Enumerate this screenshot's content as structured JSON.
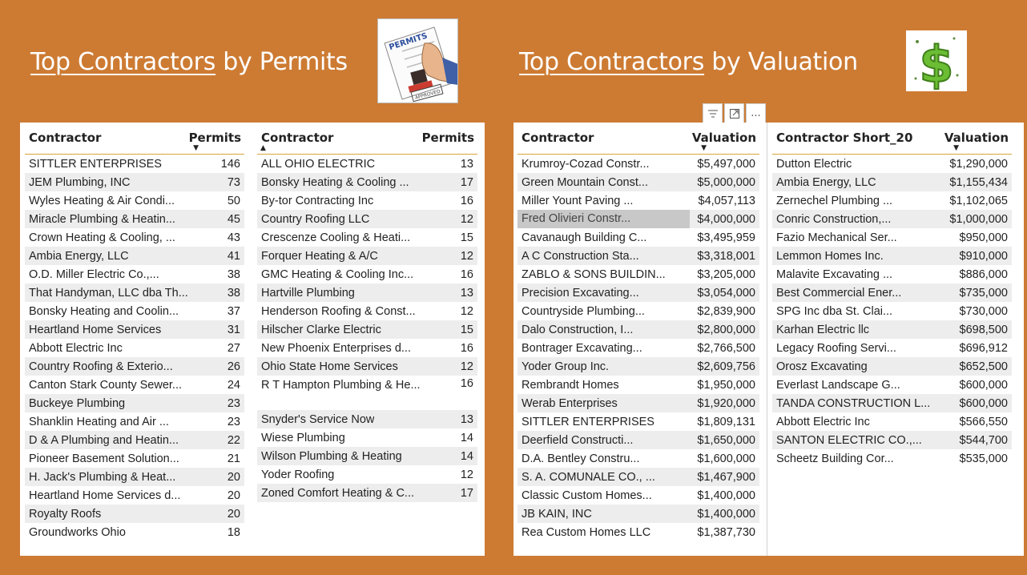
{
  "permits_section": {
    "title_link": "Top Contractors",
    "title_rest": " by Permits"
  },
  "valuation_section": {
    "title_link": "Top Contractors",
    "title_rest": " by Valuation"
  },
  "icons": {
    "permits": "permits-approved-stamp-icon",
    "dollar": "dollar-sign-icon"
  },
  "permits_table_1": {
    "headers": [
      "Contractor",
      "Permits"
    ],
    "sort": "descending-on-Permits",
    "rows": [
      [
        "SITTLER ENTERPRISES",
        "146"
      ],
      [
        "JEM Plumbing, INC",
        "73"
      ],
      [
        "Wyles Heating & Air Condi...",
        "50"
      ],
      [
        "Miracle Plumbing & Heatin...",
        "45"
      ],
      [
        "Crown Heating & Cooling, ...",
        "43"
      ],
      [
        "Ambia Energy, LLC",
        "41"
      ],
      [
        "O.D. Miller Electric Co.,...",
        "38"
      ],
      [
        "That Handyman, LLC dba Th...",
        "38"
      ],
      [
        "Bonsky Heating and Coolin...",
        "37"
      ],
      [
        "Heartland Home Services",
        "31"
      ],
      [
        "Abbott Electric Inc",
        "27"
      ],
      [
        "Country Roofing & Exterio...",
        "26"
      ],
      [
        "Canton Stark County Sewer...",
        "24"
      ],
      [
        "Buckeye Plumbing",
        "23"
      ],
      [
        "Shanklin Heating and Air ...",
        "23"
      ],
      [
        "D & A Plumbing and Heatin...",
        "22"
      ],
      [
        "Pioneer Basement Solution...",
        "21"
      ],
      [
        "H. Jack's Plumbing & Heat...",
        "20"
      ],
      [
        "Heartland Home Services d...",
        "20"
      ],
      [
        "Royalty Roofs",
        "20"
      ],
      [
        "Groundworks Ohio",
        "18"
      ]
    ]
  },
  "permits_table_2": {
    "headers": [
      "Contractor",
      "Permits"
    ],
    "sort": "ascending-on-Contractor",
    "rows": [
      [
        "ALL OHIO ELECTRIC",
        "13"
      ],
      [
        "Bonsky Heating & Cooling ...",
        "17"
      ],
      [
        "By-tor Contracting Inc",
        "16"
      ],
      [
        "Country Roofing LLC",
        "12"
      ],
      [
        "Crescenze Cooling & Heati...",
        "15"
      ],
      [
        "Forquer Heating & A/C",
        "12"
      ],
      [
        "GMC Heating & Cooling Inc...",
        "16"
      ],
      [
        "Hartville Plumbing",
        "13"
      ],
      [
        "Henderson Roofing & Const...",
        "12"
      ],
      [
        "Hilscher Clarke Electric",
        "15"
      ],
      [
        "New Phoenix Enterprises d...",
        "16"
      ],
      [
        "Ohio State Home Services",
        "12"
      ],
      [
        "R T Hampton Plumbing & He...",
        "16"
      ],
      [
        "Snyder's Service Now",
        "13"
      ],
      [
        "Wiese Plumbing",
        "14"
      ],
      [
        "Wilson Plumbing & Heating",
        "14"
      ],
      [
        "Yoder Roofing",
        "12"
      ],
      [
        "Zoned Comfort Heating & C...",
        "17"
      ]
    ]
  },
  "valuation_table_1": {
    "headers": [
      "Contractor",
      "Valuation"
    ],
    "sort": "descending-on-Valuation",
    "selected_row": 3,
    "rows": [
      [
        "Krumroy-Cozad Constr...",
        "$5,497,000"
      ],
      [
        "Green Mountain Const...",
        "$5,000,000"
      ],
      [
        "Miller Yount Paving ...",
        "$4,057,113"
      ],
      [
        "Fred Olivieri Constr...",
        "$4,000,000"
      ],
      [
        "Cavanaugh Building C...",
        "$3,495,959"
      ],
      [
        "A C Construction Sta...",
        "$3,318,001"
      ],
      [
        "ZABLO & SONS BUILDIN...",
        "$3,205,000"
      ],
      [
        "Precision Excavating...",
        "$3,054,000"
      ],
      [
        "Countryside Plumbing...",
        "$2,839,900"
      ],
      [
        "Dalo Construction, I...",
        "$2,800,000"
      ],
      [
        "Bontrager Excavating...",
        "$2,766,500"
      ],
      [
        "Yoder Group Inc.",
        "$2,609,756"
      ],
      [
        "Rembrandt Homes",
        "$1,950,000"
      ],
      [
        "Werab Enterprises",
        "$1,920,000"
      ],
      [
        "SITTLER ENTERPRISES",
        "$1,809,131"
      ],
      [
        "Deerfield Constructi...",
        "$1,650,000"
      ],
      [
        "D.A. Bentley Constru...",
        "$1,600,000"
      ],
      [
        "S. A. COMUNALE CO., ...",
        "$1,467,900"
      ],
      [
        "Classic Custom Homes...",
        "$1,400,000"
      ],
      [
        "JB KAIN, INC",
        "$1,400,000"
      ],
      [
        "Rea Custom Homes LLC",
        "$1,387,730"
      ]
    ]
  },
  "valuation_table_2": {
    "headers": [
      "Contractor Short_20",
      "Valuation"
    ],
    "sort": "descending-on-Valuation",
    "rows": [
      [
        "Dutton Electric",
        "$1,290,000"
      ],
      [
        "Ambia Energy, LLC",
        "$1,155,434"
      ],
      [
        "Zernechel Plumbing ...",
        "$1,102,065"
      ],
      [
        "Conric Construction,...",
        "$1,000,000"
      ],
      [
        "Fazio Mechanical Ser...",
        "$950,000"
      ],
      [
        "Lemmon Homes Inc.",
        "$910,000"
      ],
      [
        "Malavite Excavating ...",
        "$886,000"
      ],
      [
        "Best Commercial Ener...",
        "$735,000"
      ],
      [
        "SPG Inc dba St. Clai...",
        "$730,000"
      ],
      [
        "Karhan Electric llc",
        "$698,500"
      ],
      [
        "Legacy Roofing Servi...",
        "$696,912"
      ],
      [
        "Orosz Excavating",
        "$652,500"
      ],
      [
        "Everlast Landscape G...",
        "$600,000"
      ],
      [
        "TANDA CONSTRUCTION L...",
        "$600,000"
      ],
      [
        "Abbott Electric Inc",
        "$566,550"
      ],
      [
        "SANTON ELECTRIC CO.,...",
        "$544,700"
      ],
      [
        "Scheetz Building Cor...",
        "$535,000"
      ]
    ]
  },
  "toolbar": {
    "filter_icon": "filter-icon",
    "focus_icon": "focus-mode-icon",
    "more_label": "..."
  }
}
